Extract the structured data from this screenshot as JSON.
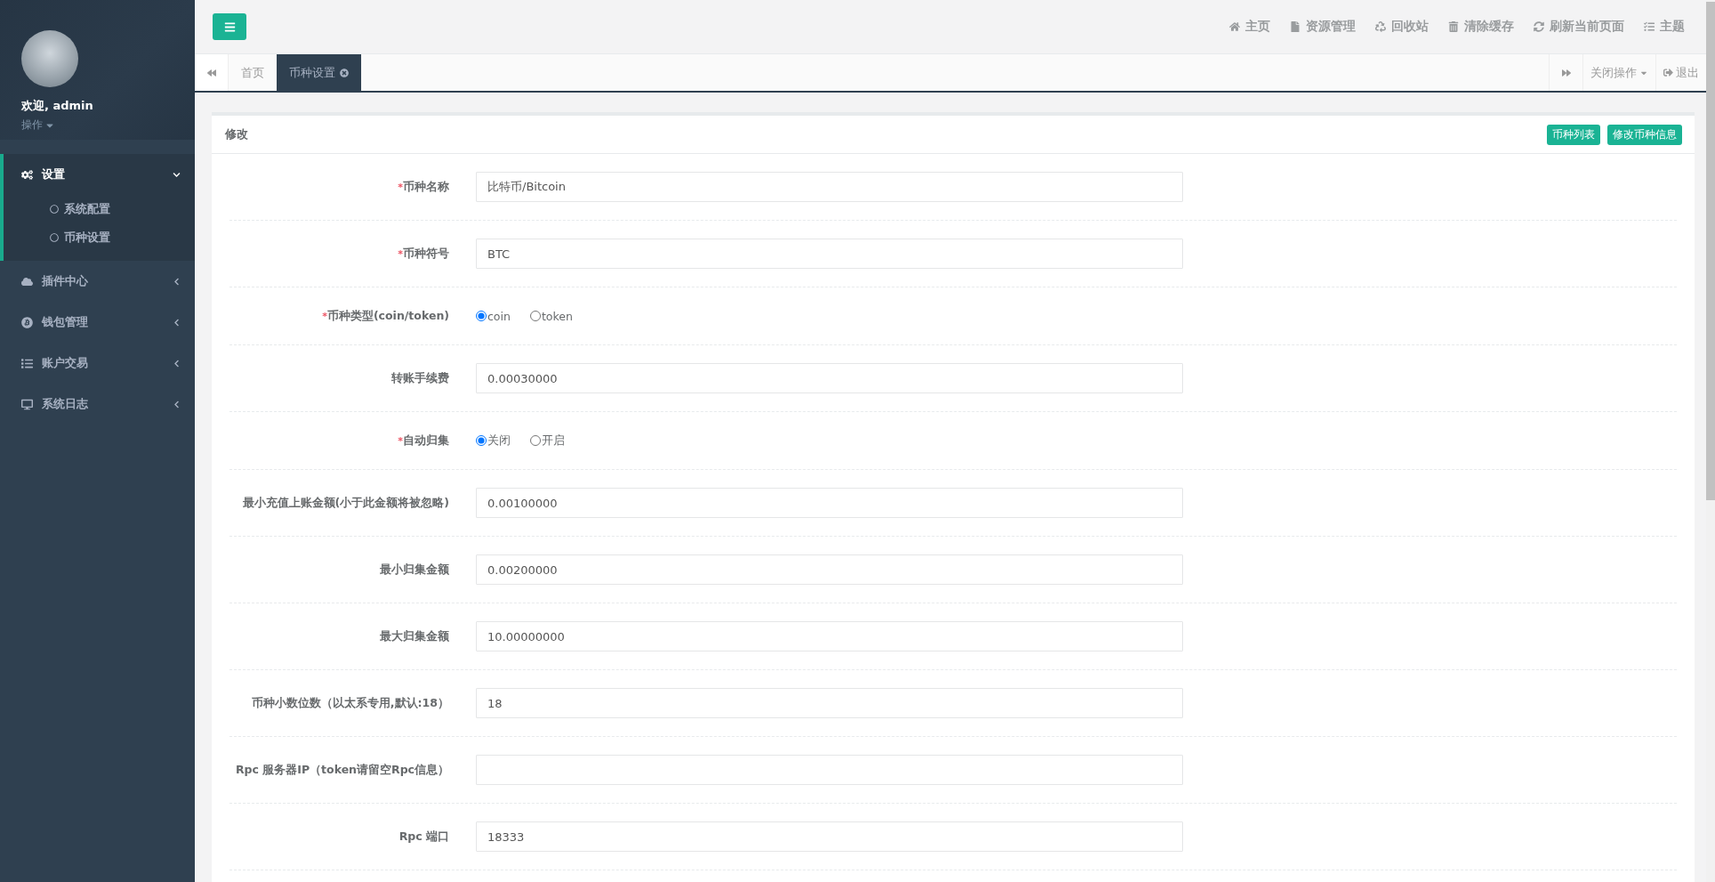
{
  "sidebar": {
    "user": {
      "greeting": "欢迎, admin",
      "menu": "操作"
    },
    "nav": [
      {
        "label": "设置",
        "expanded": true,
        "children": [
          {
            "label": "系统配置"
          },
          {
            "label": "币种设置"
          }
        ]
      },
      {
        "label": "插件中心",
        "expanded": false
      },
      {
        "label": "钱包管理",
        "expanded": false
      },
      {
        "label": "账户交易",
        "expanded": false
      },
      {
        "label": "系统日志",
        "expanded": false
      }
    ]
  },
  "topbar": {
    "links": [
      "主页",
      "资源管理",
      "回收站",
      "清除缓存",
      "刷新当前页面",
      "主题"
    ]
  },
  "tabs": [
    {
      "label": "首页",
      "selected": false
    },
    {
      "label": "币种设置",
      "selected": true
    }
  ],
  "tab_actions": {
    "close_menu": "关闭操作",
    "logout": "退出"
  },
  "card": {
    "title": "修改",
    "buttons": [
      "币种列表",
      "修改币种信息"
    ],
    "fields": [
      {
        "kind": "input",
        "marker": "*",
        "label": "币种名称",
        "value": "比特币/Bitcoin"
      },
      {
        "kind": "input",
        "marker": "*",
        "label": "币种符号",
        "value": "BTC"
      },
      {
        "kind": "radio",
        "marker": "*",
        "label": "币种类型(coin/token)",
        "options": [
          {
            "label": "coin",
            "selected": true
          },
          {
            "label": "token",
            "selected": false
          }
        ]
      },
      {
        "kind": "input",
        "label": "转账手续费",
        "value": "0.00030000"
      },
      {
        "kind": "radio",
        "marker": "*",
        "label": "自动归集",
        "options": [
          {
            "label": "关闭",
            "selected": true
          },
          {
            "label": "开启",
            "selected": false
          }
        ]
      },
      {
        "kind": "input",
        "label": "最小充值上账金额(小于此金额将被忽略)",
        "value": "0.00100000"
      },
      {
        "kind": "input",
        "label": "最小归集金额",
        "value": "0.00200000"
      },
      {
        "kind": "input",
        "label": "最大归集金额",
        "value": "10.00000000"
      },
      {
        "kind": "input",
        "label": "币种小数位数（以太系专用,默认:18）",
        "value": "18"
      },
      {
        "kind": "input",
        "label": "Rpc 服务器IP（token请留空Rpc信息）"
      },
      {
        "kind": "input",
        "label": "Rpc 端口",
        "value": "18333"
      }
    ]
  }
}
